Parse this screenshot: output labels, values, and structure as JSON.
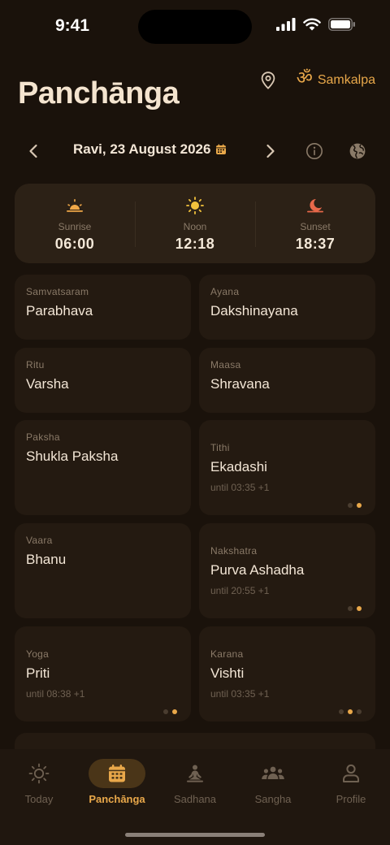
{
  "status": {
    "time": "9:41"
  },
  "header": {
    "title": "Panchānga",
    "samkalpa_label": "Samkalpa",
    "om_symbol": "ॐ"
  },
  "date_nav": {
    "date_label": "Ravi, 23 August 2026"
  },
  "sun": {
    "sunrise": {
      "label": "Sunrise",
      "value": "06:00",
      "icon": "sunrise-icon",
      "color": "#f0a848"
    },
    "noon": {
      "label": "Noon",
      "value": "12:18",
      "icon": "sun-icon",
      "color": "#f2c23c"
    },
    "sunset": {
      "label": "Sunset",
      "value": "18:37",
      "icon": "sunset-icon",
      "color": "#e8684a"
    }
  },
  "cards": {
    "samvatsaram": {
      "label": "Samvatsaram",
      "value": "Parabhava"
    },
    "ayana": {
      "label": "Ayana",
      "value": "Dakshinayana"
    },
    "ritu": {
      "label": "Ritu",
      "value": "Varsha"
    },
    "maasa": {
      "label": "Maasa",
      "value": "Shravana"
    },
    "paksha": {
      "label": "Paksha",
      "value": "Shukla Paksha"
    },
    "tithi": {
      "label": "Tithi",
      "value": "Ekadashi",
      "sub": "until 03:35 +1"
    },
    "vaara": {
      "label": "Vaara",
      "value": "Bhanu"
    },
    "nakshatra": {
      "label": "Nakshatra",
      "value": "Purva Ashadha",
      "sub": "until 20:55 +1"
    },
    "yoga": {
      "label": "Yoga",
      "value": "Priti",
      "sub": "until 08:38 +1"
    },
    "karana": {
      "label": "Karana",
      "value": "Vishti",
      "sub": "until 03:35 +1"
    }
  },
  "tabs": [
    {
      "label": "Today",
      "icon": "sun-icon"
    },
    {
      "label": "Panchānga",
      "icon": "calendar-icon",
      "active": true
    },
    {
      "label": "Sadhana",
      "icon": "meditation-icon"
    },
    {
      "label": "Sangha",
      "icon": "group-icon"
    },
    {
      "label": "Profile",
      "icon": "person-icon"
    }
  ],
  "colors": {
    "accent": "#e9a84a",
    "background": "#1a120b",
    "card": "#241a11"
  }
}
